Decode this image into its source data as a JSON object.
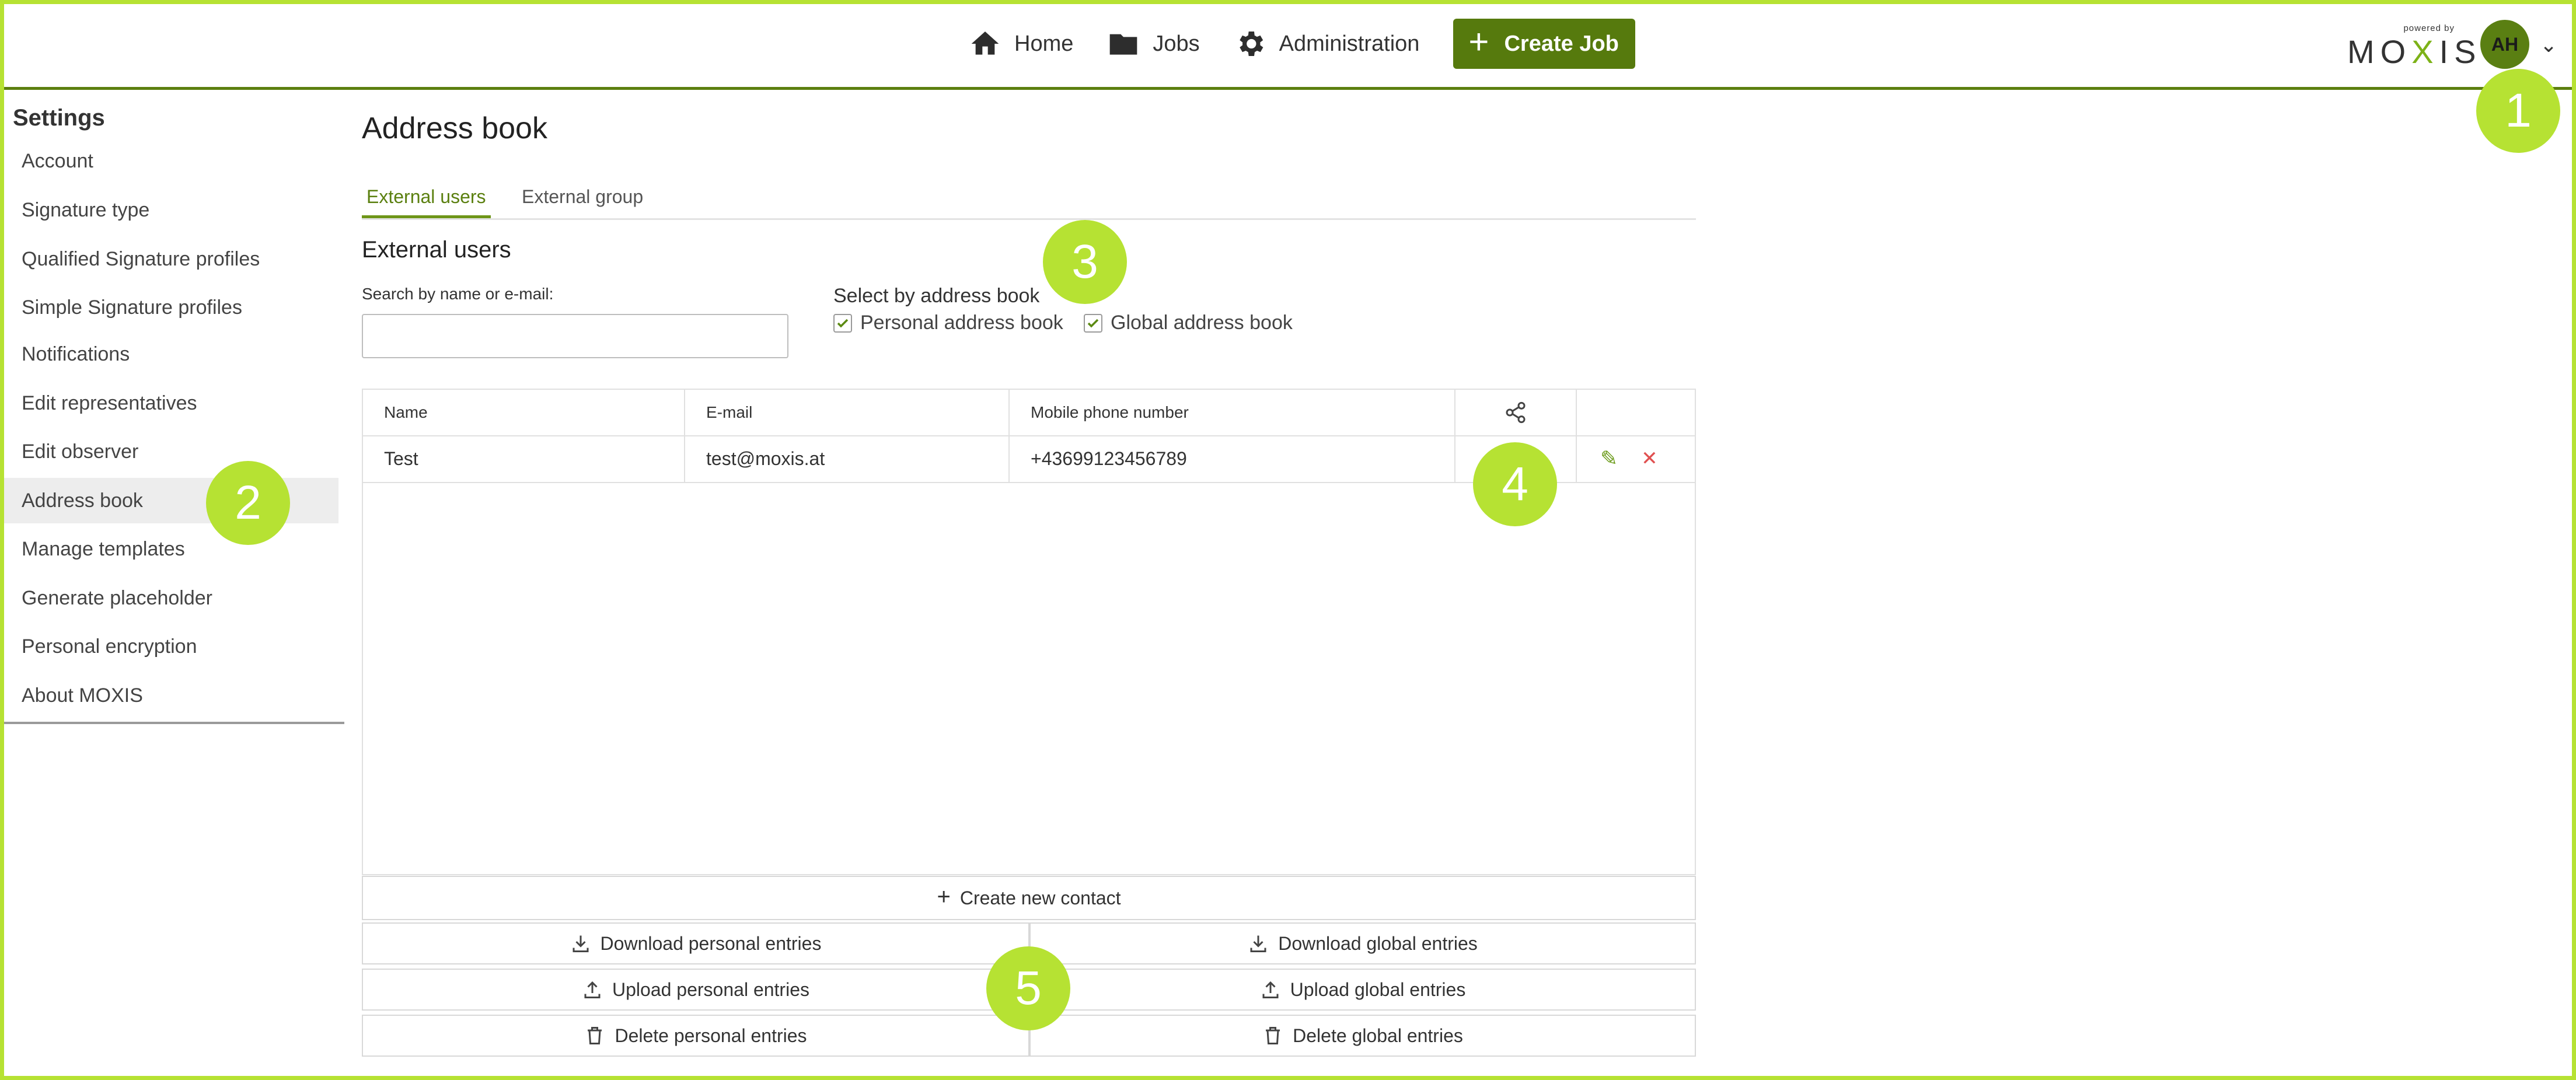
{
  "nav": {
    "items": [
      {
        "label": "Home",
        "icon": "home-icon"
      },
      {
        "label": "Jobs",
        "icon": "folder-icon"
      },
      {
        "label": "Administration",
        "icon": "gear-icon"
      }
    ],
    "create_label": "Create Job"
  },
  "brand": {
    "powered_by": "powered by",
    "name_left": "MO",
    "name_x": "X",
    "name_right": "IS",
    "accent_color": "#7db218"
  },
  "user": {
    "initials": "AH"
  },
  "markers": [
    "1",
    "2",
    "3",
    "4",
    "5"
  ],
  "sidebar": {
    "title": "Settings",
    "items": [
      {
        "label": "Account"
      },
      {
        "label": "Signature type"
      },
      {
        "label": "Qualified Signature profiles"
      },
      {
        "label": "Simple Signature profiles"
      },
      {
        "label": "Notifications"
      },
      {
        "label": "Edit representatives"
      },
      {
        "label": "Edit observer"
      },
      {
        "label": "Address book"
      },
      {
        "label": "Manage templates"
      },
      {
        "label": "Generate placeholder"
      },
      {
        "label": "Personal encryption"
      },
      {
        "label": "About MOXIS"
      }
    ],
    "active": "Address book"
  },
  "main": {
    "title": "Address book",
    "tabs": [
      {
        "label": "External users"
      },
      {
        "label": "External group"
      }
    ],
    "section_title": "External users",
    "search": {
      "label": "Search by name or e-mail:",
      "value": "",
      "placeholder": ""
    },
    "select": {
      "label": "Select by address book",
      "options": [
        {
          "label": "Personal address book",
          "checked": true
        },
        {
          "label": "Global address book",
          "checked": true
        }
      ]
    },
    "table": {
      "columns": [
        "Name",
        "E-mail",
        "Mobile phone number"
      ],
      "rows": [
        {
          "name": "Test",
          "email": "test@moxis.at",
          "phone": "+43699123456789"
        }
      ]
    },
    "buttons": {
      "create": "Create new contact",
      "download_personal": "Download personal entries",
      "download_global": "Download global entries",
      "upload_personal": "Upload personal entries",
      "upload_global": "Upload global entries",
      "delete_personal": "Delete personal entries",
      "delete_global": "Delete global entries"
    }
  },
  "colors": {
    "primary": "#567a0d",
    "highlight": "#b6e233",
    "danger": "#e05050"
  }
}
